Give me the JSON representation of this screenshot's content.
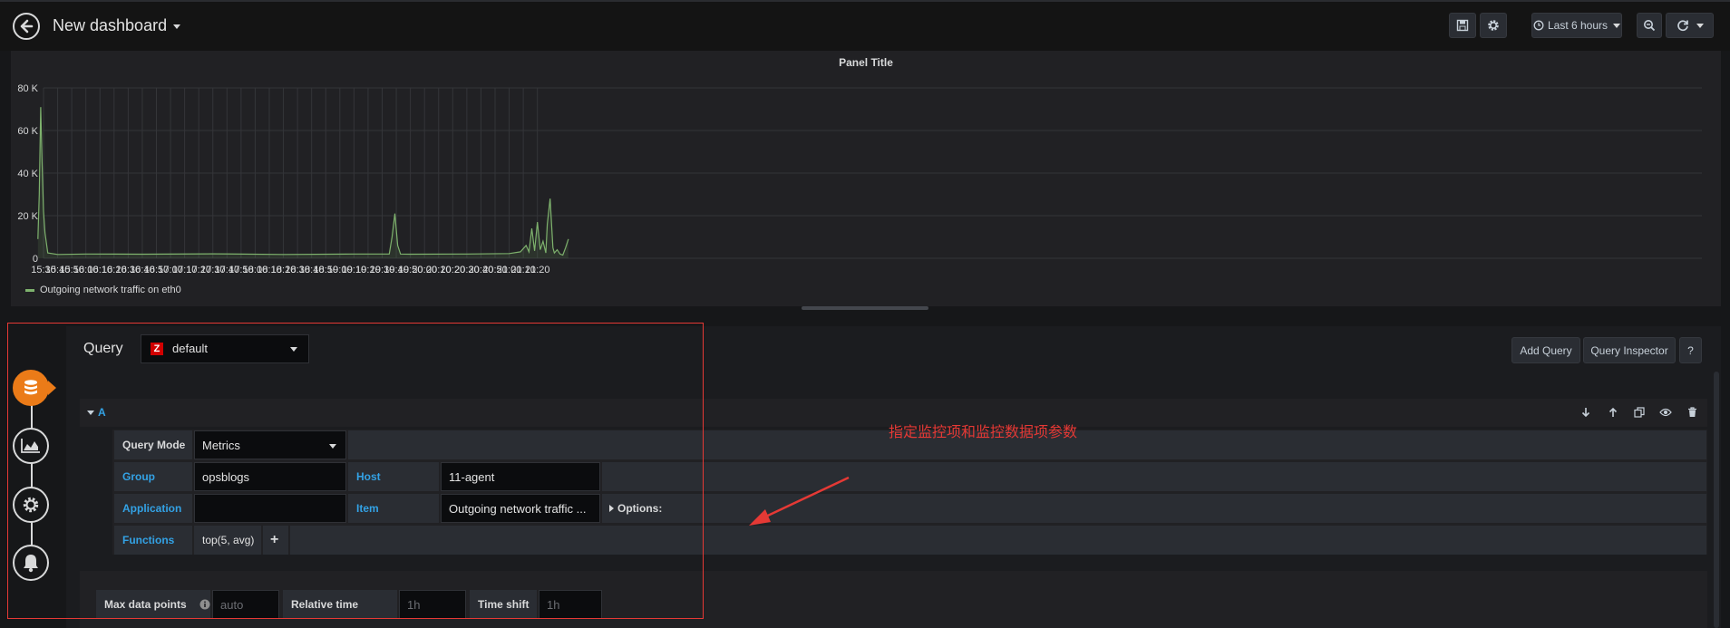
{
  "header": {
    "title": "New dashboard",
    "time_range": "Last 6 hours"
  },
  "panel": {
    "title": "Panel Title",
    "legend": "Outgoing network traffic on eth0"
  },
  "chart_data": {
    "type": "line",
    "title": "Panel Title",
    "xlabel": "",
    "ylabel": "",
    "y_tick_labels": [
      "0",
      "20 K",
      "40 K",
      "60 K",
      "80 K"
    ],
    "ylim": [
      0,
      80000
    ],
    "x_tick_labels": [
      "15:30",
      "15:40",
      "15:50",
      "16:00",
      "16:10",
      "16:20",
      "16:30",
      "16:40",
      "16:50",
      "17:00",
      "17:10",
      "17:20",
      "17:30",
      "17:40",
      "17:50",
      "18:00",
      "18:10",
      "18:20",
      "18:30",
      "18:40",
      "18:50",
      "19:00",
      "19:10",
      "19:20",
      "19:30",
      "19:40",
      "19:50",
      "20:00",
      "20:10",
      "20:20",
      "20:30",
      "20:40",
      "20:50",
      "21:00",
      "21:10",
      "21:20"
    ],
    "grid": true,
    "legend_position": "bottom-left",
    "series": [
      {
        "name": "Outgoing network traffic on eth0",
        "color": "#7eb26d",
        "x_minutes": [
          926,
          927,
          928,
          929,
          930,
          931,
          933,
          940,
          960,
          1000,
          1050,
          1100,
          1150,
          1175,
          1177,
          1179,
          1181,
          1183,
          1190,
          1230,
          1260,
          1268,
          1272,
          1274,
          1276,
          1278,
          1280,
          1282,
          1284,
          1286,
          1287,
          1289,
          1291,
          1292,
          1294,
          1296,
          1298,
          1300,
          1302
        ],
        "y": [
          9000,
          30000,
          71000,
          45000,
          22000,
          12000,
          2500,
          1800,
          2000,
          1900,
          2100,
          1800,
          2000,
          2000,
          10000,
          21000,
          6000,
          2000,
          1900,
          2000,
          2200,
          3000,
          6000,
          3000,
          14000,
          3500,
          17000,
          4000,
          8000,
          2500,
          16000,
          28000,
          5000,
          2500,
          4000,
          2000,
          1500,
          5000,
          9000
        ]
      }
    ]
  },
  "query": {
    "label": "Query",
    "datasource_logo": "Z",
    "datasource": "default",
    "add_query": "Add Query",
    "inspector": "Query Inspector",
    "help": "?",
    "row_label": "A",
    "fields": {
      "mode_label": "Query Mode",
      "mode_value": "Metrics",
      "group_label": "Group",
      "group_value": "opsblogs",
      "host_label": "Host",
      "host_value": "11-agent",
      "application_label": "Application",
      "application_value": "",
      "item_label": "Item",
      "item_value": "Outgoing network traffic ...",
      "options_label": "Options:",
      "functions_label": "Functions",
      "function_value": "top(5, avg)",
      "add_function": "+"
    },
    "options": {
      "max_data_points_label": "Max data points",
      "max_data_points_placeholder": "auto",
      "relative_time_label": "Relative time",
      "relative_time_placeholder": "1h",
      "time_shift_label": "Time shift",
      "time_shift_placeholder": "1h"
    }
  },
  "annotation": {
    "text": "指定监控项和监控数据项参数",
    "color": "#e53935"
  }
}
